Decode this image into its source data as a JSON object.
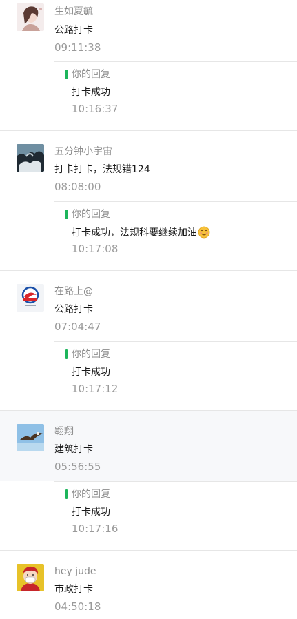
{
  "reply_label": "你的回复",
  "messages": [
    {
      "user": "生如夏毓",
      "text": "公路打卡",
      "time": "09:11:38",
      "reply": {
        "text": "打卡成功",
        "time": "10:16:37"
      }
    },
    {
      "user": "五分钟小宇宙",
      "text": "打卡打卡，法规错124",
      "time": "08:08:00",
      "reply": {
        "text": "打卡成功，法规科要继续加油",
        "emoji": "smiling-face-emoji",
        "time": "10:17:08"
      }
    },
    {
      "user": "在路上@",
      "text": "公路打卡",
      "time": "07:04:47",
      "reply": {
        "text": "打卡成功",
        "time": "10:17:12"
      }
    },
    {
      "user": "翱翔",
      "text": "建筑打卡",
      "time": "05:56:55",
      "reply": {
        "text": "打卡成功",
        "time": "10:17:16"
      }
    },
    {
      "user": "hey jude",
      "text": "市政打卡",
      "time": "04:50:18"
    }
  ],
  "colors": {
    "accent": "#1db55b",
    "highlight_bg": "#f7f8fa",
    "divider": "#e6e6e6"
  }
}
